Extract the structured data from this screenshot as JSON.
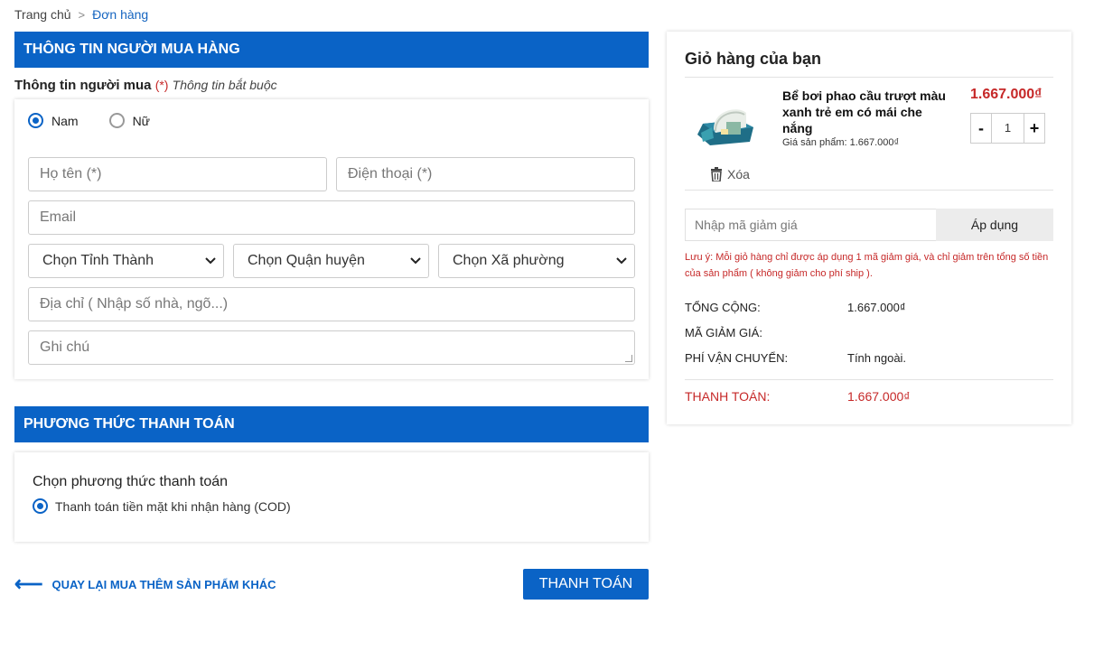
{
  "breadcrumb": {
    "home": "Trang chủ",
    "separator": ">",
    "current": "Đơn hàng"
  },
  "buyer": {
    "section_title": "THÔNG TIN NGƯỜI MUA HÀNG",
    "subheading": "Thông tin người mua",
    "required_mark": "(*)",
    "required_note": "Thông tin bắt buộc",
    "gender": {
      "options": [
        "Nam",
        "Nữ"
      ],
      "selected": "Nam"
    },
    "fields": {
      "name_placeholder": "Họ tên (*)",
      "phone_placeholder": "Điện thoại (*)",
      "email_placeholder": "Email",
      "province": "Chọn Tỉnh Thành",
      "district": "Chọn Quận huyện",
      "ward": "Chọn Xã phường",
      "address_placeholder": "Địa chỉ ( Nhập số nhà, ngõ...)",
      "note_placeholder": "Ghi chú"
    }
  },
  "payment": {
    "section_title": "PHƯƠNG THỨC THANH TOÁN",
    "choose_label": "Chọn phương thức thanh toán",
    "option": "Thanh toán tiền mặt khi nhận hàng (COD)"
  },
  "actions": {
    "back_arrow": "⟵",
    "back_label": "QUAY LẠI MUA THÊM SẢN PHẨM KHÁC",
    "pay_label": "THANH TOÁN"
  },
  "cart": {
    "title": "Giỏ hàng của bạn",
    "item": {
      "name": "Bể bơi phao cầu trượt màu xanh trẻ em có mái che nắng",
      "unit_price_label": "Giá sản phẩm: 1.667.000₫",
      "price": "1.667.000₫",
      "quantity": "1",
      "minus": "-",
      "plus": "+",
      "remove_label": "Xóa"
    },
    "coupon": {
      "placeholder": "Nhập mã giảm giá",
      "apply_label": "Áp dụng"
    },
    "note": "Lưu ý: Mỗi giỏ hàng chỉ được áp dụng 1 mã giảm giá, và chỉ giảm trên tổng số tiền của sản phẩm ( không giảm cho phí ship ).",
    "summary": {
      "total_label": "TỔNG CỘNG:",
      "total_value": "1.667.000₫",
      "discount_label": "MÃ GIẢM GIÁ:",
      "discount_value": "",
      "shipping_label": "PHÍ VẬN CHUYỂN:",
      "shipping_value": "Tính ngoài.",
      "grand_label": "THANH TOÁN:",
      "grand_value": "1.667.000₫"
    }
  },
  "colors": {
    "primary": "#0a63c6",
    "accent_red": "#c62828"
  },
  "icons": {
    "breadcrumb_sep": "chevron-right-icon",
    "remove": "trash-icon",
    "back": "arrow-left-icon",
    "select": "chevron-down-icon"
  }
}
